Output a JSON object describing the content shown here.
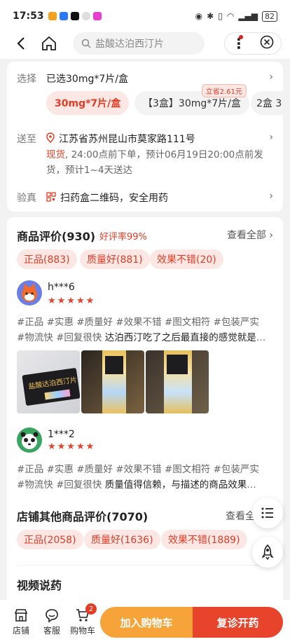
{
  "status": {
    "time": "17:53",
    "battery": "82"
  },
  "nav": {
    "search_placeholder": "盐酸达泊西汀片"
  },
  "spec": {
    "label": "选择",
    "selected": "已选30mg*7片/盒",
    "options": [
      "30mg*7片/盒",
      "【3盒】30mg*7片/盒",
      "2盒 3"
    ],
    "promo": "立省2.61元"
  },
  "delivery": {
    "label": "送至",
    "address": "江苏省苏州昆山市莫家路111号",
    "status_word": "现货",
    "line1_rest": ", 24:00点前下单，预计06月19日20:00点前发",
    "line2": "货，预计1~4天送达"
  },
  "verify": {
    "label": "验真",
    "text": "扫药盒二维码，安全用药"
  },
  "reviews": {
    "title": "商品评价(930)",
    "rate": "好评率99%",
    "view_all": "查看全部",
    "tags": [
      "正品(883)",
      "质量好(881)",
      "效果不错(20)"
    ],
    "items": [
      {
        "user": "h***6",
        "stars": "★★★★★",
        "line1": "#正品 #实惠 #质量好 #效果不错 #图文相符 #包装严实",
        "line2_tags": "#物流快 #回复很快 ",
        "line2_text": "达泊西汀吃了之后最直接的感觉就是龟...",
        "photo_text": "盐酸达泊西汀片"
      },
      {
        "user": "1***2",
        "stars": "★★★★★",
        "line1": "#正品 #实惠 #质量好 #效果不错 #图文相符 #包装严实",
        "line2_tags": "#物流快 #回复很快 ",
        "line2_text": "质量值得信赖，与描述的商品效果一样..."
      }
    ]
  },
  "store_reviews": {
    "title": "店铺其他商品评价(7070)",
    "view_all": "查看全",
    "tags": [
      "正品(2058)",
      "质量好(1636)",
      "效果不错(1889)"
    ]
  },
  "video": {
    "title": "视频说药"
  },
  "bottom": {
    "shop": "店铺",
    "service": "客服",
    "cart": "购物车",
    "cart_count": "2",
    "add_cart": "加入购物车",
    "consult": "复诊开药"
  }
}
